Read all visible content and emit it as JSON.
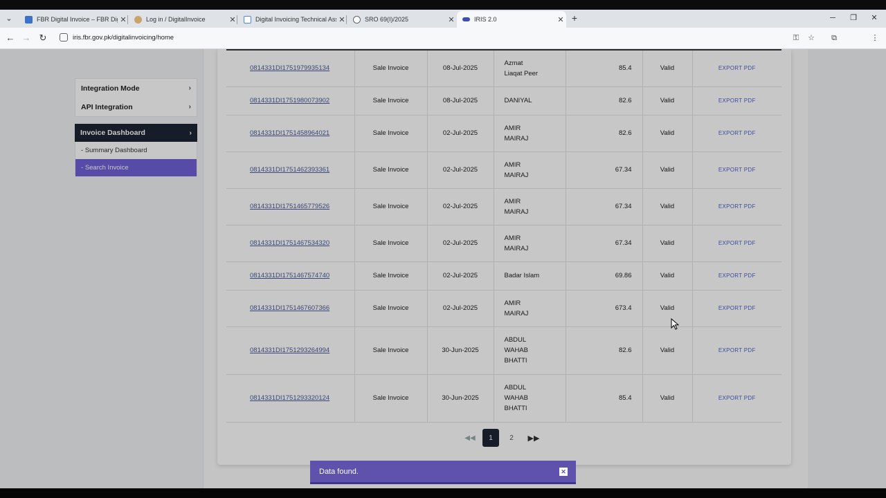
{
  "browser": {
    "tabs": [
      {
        "title": "FBR Digital Invoice – FBR Digital",
        "favicon_color": "#3b73c9",
        "active": false
      },
      {
        "title": "Log in / DigitalInvoice",
        "favicon_color": "#c9a46a",
        "active": false
      },
      {
        "title": "Digital Invoicing Technical Assis",
        "favicon_color": "#4a86e8",
        "active": false
      },
      {
        "title": "SRO 69(I)/2025",
        "favicon_color": "#5f6368",
        "active": false
      },
      {
        "title": "IRIS 2.0",
        "favicon_color": "#3d4fb5",
        "active": true
      }
    ],
    "url": "iris.fbr.gov.pk/digitalinvoicing/home"
  },
  "sidebar": {
    "items": [
      {
        "label": "Integration Mode"
      },
      {
        "label": "API Integration"
      }
    ],
    "section": {
      "label": "Invoice Dashboard"
    },
    "subitems": [
      {
        "label": "Summary Dashboard",
        "active": false
      },
      {
        "label": "Search Invoice",
        "active": true
      }
    ]
  },
  "invoices": [
    {
      "no": "0814331DI1751979935134",
      "type": "Sale Invoice",
      "date": "08-Jul-2025",
      "buyer": [
        "Azmat",
        "Liaqat Peer"
      ],
      "amount": "85.4",
      "status": "Valid",
      "action": "EXPORT PDF"
    },
    {
      "no": "0814331DI1751980073902",
      "type": "Sale Invoice",
      "date": "08-Jul-2025",
      "buyer": [
        "DANIYAL"
      ],
      "amount": "82.6",
      "status": "Valid",
      "action": "EXPORT PDF"
    },
    {
      "no": "0814331DI1751458964021",
      "type": "Sale Invoice",
      "date": "02-Jul-2025",
      "buyer": [
        "AMIR",
        "MAIRAJ"
      ],
      "amount": "82.6",
      "status": "Valid",
      "action": "EXPORT PDF"
    },
    {
      "no": "0814331DI1751462393361",
      "type": "Sale Invoice",
      "date": "02-Jul-2025",
      "buyer": [
        "AMIR",
        "MAIRAJ"
      ],
      "amount": "67.34",
      "status": "Valid",
      "action": "EXPORT PDF"
    },
    {
      "no": "0814331DI1751465779526",
      "type": "Sale Invoice",
      "date": "02-Jul-2025",
      "buyer": [
        "AMIR",
        "MAIRAJ"
      ],
      "amount": "67.34",
      "status": "Valid",
      "action": "EXPORT PDF"
    },
    {
      "no": "0814331DI1751467534320",
      "type": "Sale Invoice",
      "date": "02-Jul-2025",
      "buyer": [
        "AMIR",
        "MAIRAJ"
      ],
      "amount": "67.34",
      "status": "Valid",
      "action": "EXPORT PDF"
    },
    {
      "no": "0814331DI1751467574740",
      "type": "Sale Invoice",
      "date": "02-Jul-2025",
      "buyer": [
        "Badar Islam"
      ],
      "amount": "69.86",
      "status": "Valid",
      "action": "EXPORT PDF"
    },
    {
      "no": "0814331DI1751467607366",
      "type": "Sale Invoice",
      "date": "02-Jul-2025",
      "buyer": [
        "AMIR",
        "MAIRAJ"
      ],
      "amount": "673.4",
      "status": "Valid",
      "action": "EXPORT PDF"
    },
    {
      "no": "0814331DI1751293264994",
      "type": "Sale Invoice",
      "date": "30-Jun-2025",
      "buyer": [
        "ABDUL",
        "WAHAB",
        "BHATTI"
      ],
      "amount": "82.6",
      "status": "Valid",
      "action": "EXPORT PDF"
    },
    {
      "no": "0814331DI1751293320124",
      "type": "Sale Invoice",
      "date": "30-Jun-2025",
      "buyer": [
        "ABDUL",
        "WAHAB",
        "BHATTI"
      ],
      "amount": "85.4",
      "status": "Valid",
      "action": "EXPORT PDF"
    }
  ],
  "pagination": {
    "pages": [
      "1",
      "2"
    ],
    "current": "1",
    "first": "◀◀",
    "last": "▶▶"
  },
  "toast": {
    "message": "Data found.",
    "close": "✕"
  },
  "colors": {
    "accent": "#6f61d6",
    "sidebar_header": "#1d2635",
    "toast": "#5e52ad",
    "link": "#4b5b9a"
  }
}
